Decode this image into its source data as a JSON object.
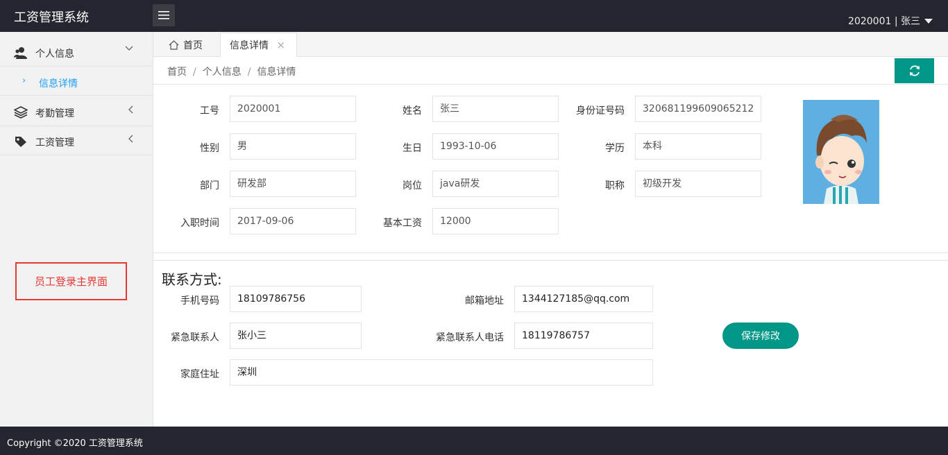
{
  "header": {
    "title": "工资管理系统",
    "user": "2020001 | 张三"
  },
  "sidebar": {
    "items": [
      {
        "label": "个人信息"
      },
      {
        "label": "信息详情"
      },
      {
        "label": "考勤管理"
      },
      {
        "label": "工资管理"
      }
    ],
    "annotation": "员工登录主界面"
  },
  "tabs": {
    "home": "首页",
    "active": "信息详情",
    "close": "×"
  },
  "breadcrumb": {
    "a": "首页",
    "b": "个人信息",
    "c": "信息详情",
    "sep": "/"
  },
  "info": {
    "emp_id": {
      "label": "工号",
      "value": "2020001"
    },
    "name": {
      "label": "姓名",
      "value": "张三"
    },
    "id_card": {
      "label": "身份证号码",
      "value": "320681199609065212"
    },
    "gender": {
      "label": "性别",
      "value": "男"
    },
    "birthday": {
      "label": "生日",
      "value": "1993-10-06"
    },
    "education": {
      "label": "学历",
      "value": "本科"
    },
    "department": {
      "label": "部门",
      "value": "研发部"
    },
    "position": {
      "label": "岗位",
      "value": "java研发"
    },
    "title": {
      "label": "职称",
      "value": "初级开发"
    },
    "hire_date": {
      "label": "入职时间",
      "value": "2017-09-06"
    },
    "base_salary": {
      "label": "基本工资",
      "value": "12000"
    }
  },
  "contact": {
    "section_title": "联系方式:",
    "phone": {
      "label": "手机号码",
      "value": "18109786756"
    },
    "email": {
      "label": "邮箱地址",
      "value": "1344127185@qq.com"
    },
    "emergency_contact": {
      "label": "紧急联系人",
      "value": "张小三"
    },
    "emergency_phone": {
      "label": "紧急联系人电话",
      "value": "18119786757"
    },
    "address": {
      "label": "家庭住址",
      "value": "深圳"
    },
    "save_label": "保存修改"
  },
  "footer": {
    "text": "Copyright ©2020 工资管理系统"
  },
  "colors": {
    "header_bg": "#23262e",
    "accent": "#009688",
    "link": "#1e9fff",
    "annotation": "#e53935"
  },
  "icons": [
    "menu-icon",
    "user-icon",
    "layers-icon",
    "tag-icon",
    "home-icon",
    "refresh-icon",
    "caret-down-icon",
    "chevron-down-icon",
    "chevron-left-icon",
    "chevron-right-icon"
  ]
}
